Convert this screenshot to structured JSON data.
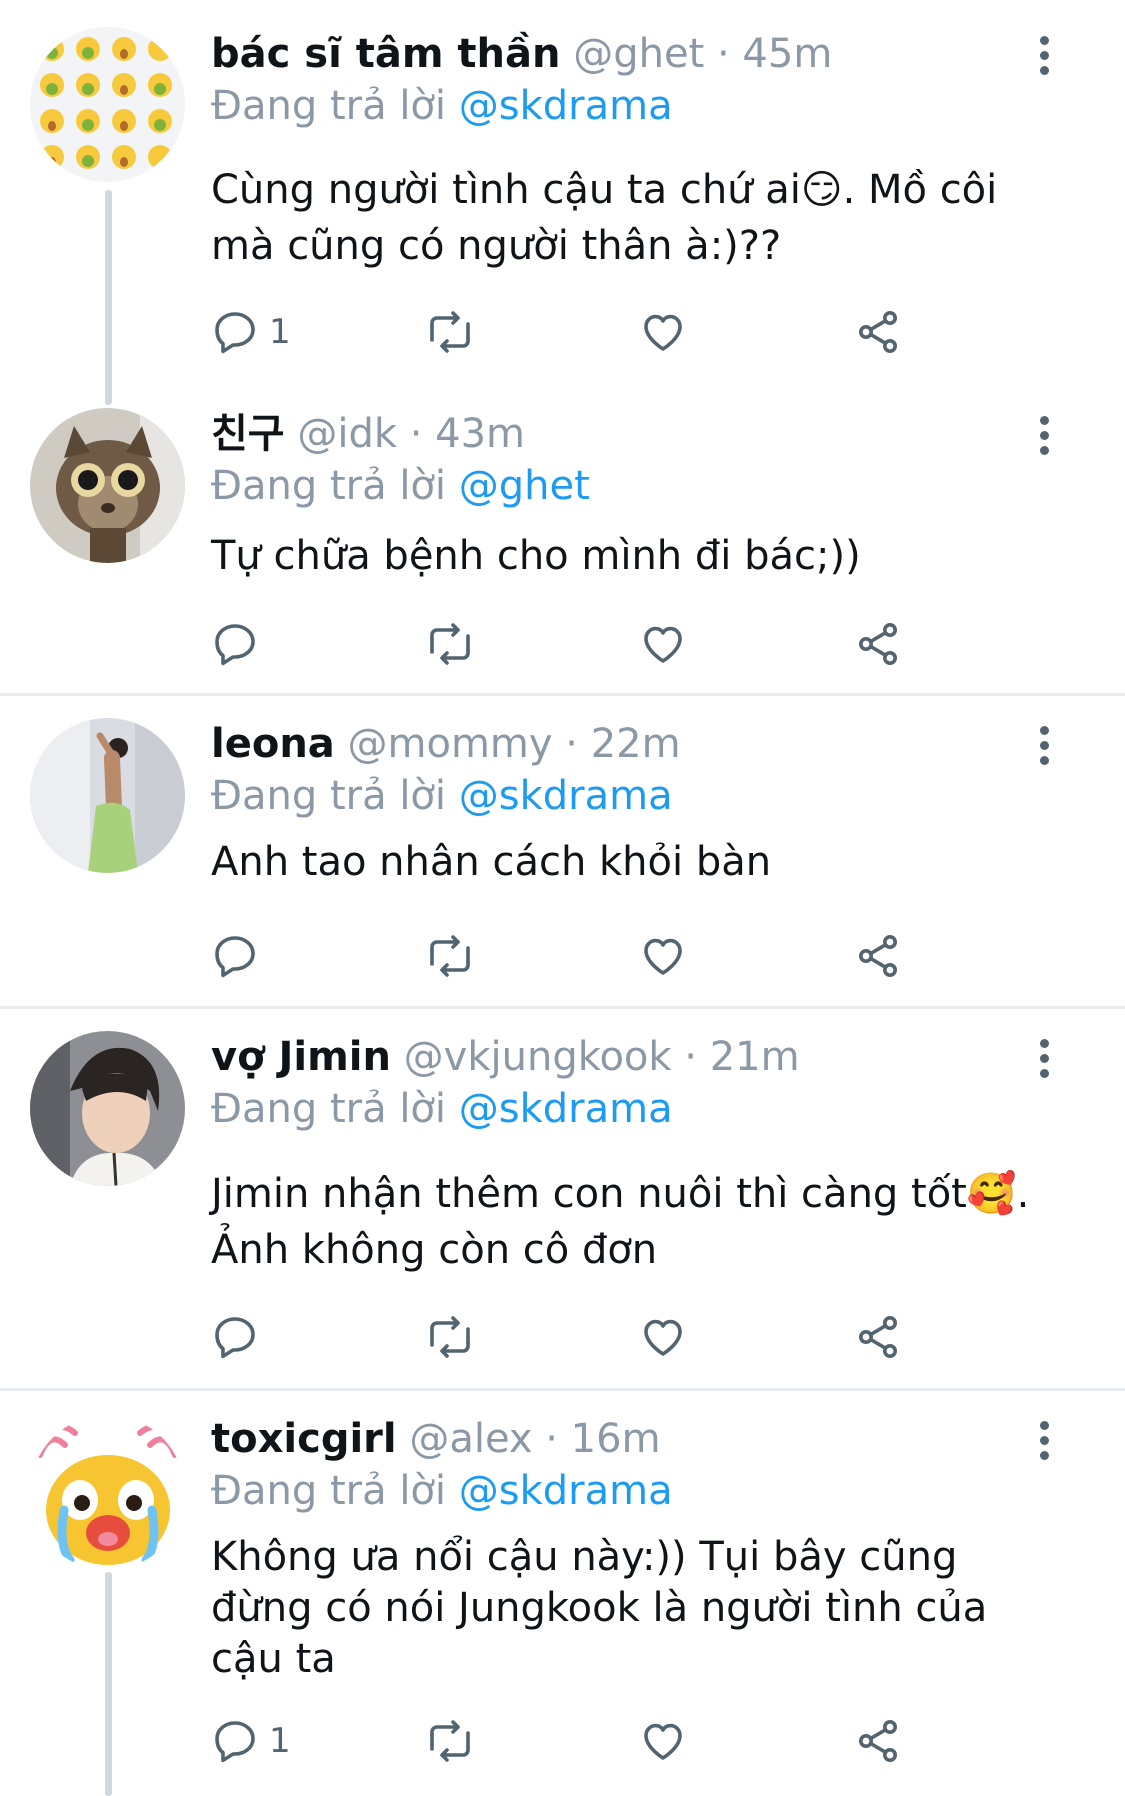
{
  "colors": {
    "accent": "#1d9bf0",
    "muted": "#8b98a5",
    "icon": "#536471",
    "divider": "#e6ecf0"
  },
  "replying_label": "Đang trả lời",
  "tweets": [
    {
      "avatar": "emoji-grid-avatar",
      "name": "bác sĩ tâm thần",
      "handle": "@ghet",
      "time": "· 45m",
      "reply_to": "@skdrama",
      "lines": [
        "Cùng người tình cậu ta chứ ai😏. Mồ côi",
        "mà cũng có người thân à:)??"
      ],
      "reply_count": "1"
    },
    {
      "avatar": "cat-avatar",
      "name": "친구",
      "handle": "@idk",
      "time": "· 43m",
      "reply_to": "@ghet",
      "lines": [
        "Tự chữa bệnh cho mình đi bác;))"
      ],
      "reply_count": ""
    },
    {
      "avatar": "woman-green-dress-avatar",
      "name": "leona",
      "handle": "@mommy",
      "time": "· 22m",
      "reply_to": "@skdrama",
      "lines": [
        "Anh tao nhân cách khỏi bàn"
      ],
      "reply_count": ""
    },
    {
      "avatar": "man-portrait-avatar",
      "name": "vợ Jimin",
      "handle": "@vkjungkook",
      "time": "· 21m",
      "reply_to": "@skdrama",
      "lines": [
        "Jimin nhận thêm con nuôi thì càng tốt🥰.",
        "Ảnh không còn cô đơn"
      ],
      "reply_count": ""
    },
    {
      "avatar": "crying-duck-avatar",
      "name": "toxicgirl",
      "handle": "@alex",
      "time": "· 16m",
      "reply_to": "@skdrama",
      "lines": [
        "Không ưa nổi cậu này:)) Tụi bây cũng",
        "đừng có nói Jungkook là người tình của",
        "cậu ta"
      ],
      "reply_count": "1"
    }
  ]
}
